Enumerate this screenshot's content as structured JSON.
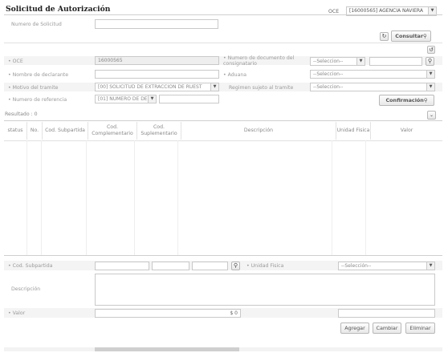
{
  "header": {
    "title": "Solicitud de Autorización",
    "oce_label": "OCE",
    "oce_selected": "[16000565] AGENCIA NAVIERA"
  },
  "search": {
    "numero_label": "Numero de Solicitud",
    "consultar_label": "Consultar"
  },
  "form": {
    "oce_label": "OCE",
    "oce_value": "16000565",
    "nombre_declarante_label": "Nombre de declarante",
    "motivo_label": "Motivo del tramite",
    "motivo_value": "[00] SOLICITUD DE EXTRACCION DE RUEST",
    "numero_referencia_label": "Numero de referencia",
    "numero_referencia_value": "[01] NUMERO DE DE",
    "numero_doc_label": "Numero de documento del consignatario",
    "numero_doc_select": "--Seleccion--",
    "aduana_label": "Aduana",
    "aduana_select": "--Seleccion--",
    "regimen_label": "Regimen sujeto al tramite",
    "regimen_select": "--Seleccion--",
    "confirmacion_label": "Confirmación"
  },
  "results": {
    "label": "Resultado : 0",
    "columns": [
      "status",
      "No.",
      "Cod. Subpartida",
      "Cod. Complementario",
      "Cod. Suplementario",
      "Descripción",
      "Unidad Fisica",
      "Valor"
    ]
  },
  "detail": {
    "subpartida_label": "Cod. Subpartida",
    "unidad_label": "Unidad Fisica",
    "unidad_select": "--Selección--",
    "descripcion_label": "Descripción",
    "valor_label": "Valor",
    "valor_value": "$ 0",
    "agregar_label": "Agregar",
    "cambiar_label": "Cambiar",
    "eliminar_label": "Eliminar"
  }
}
